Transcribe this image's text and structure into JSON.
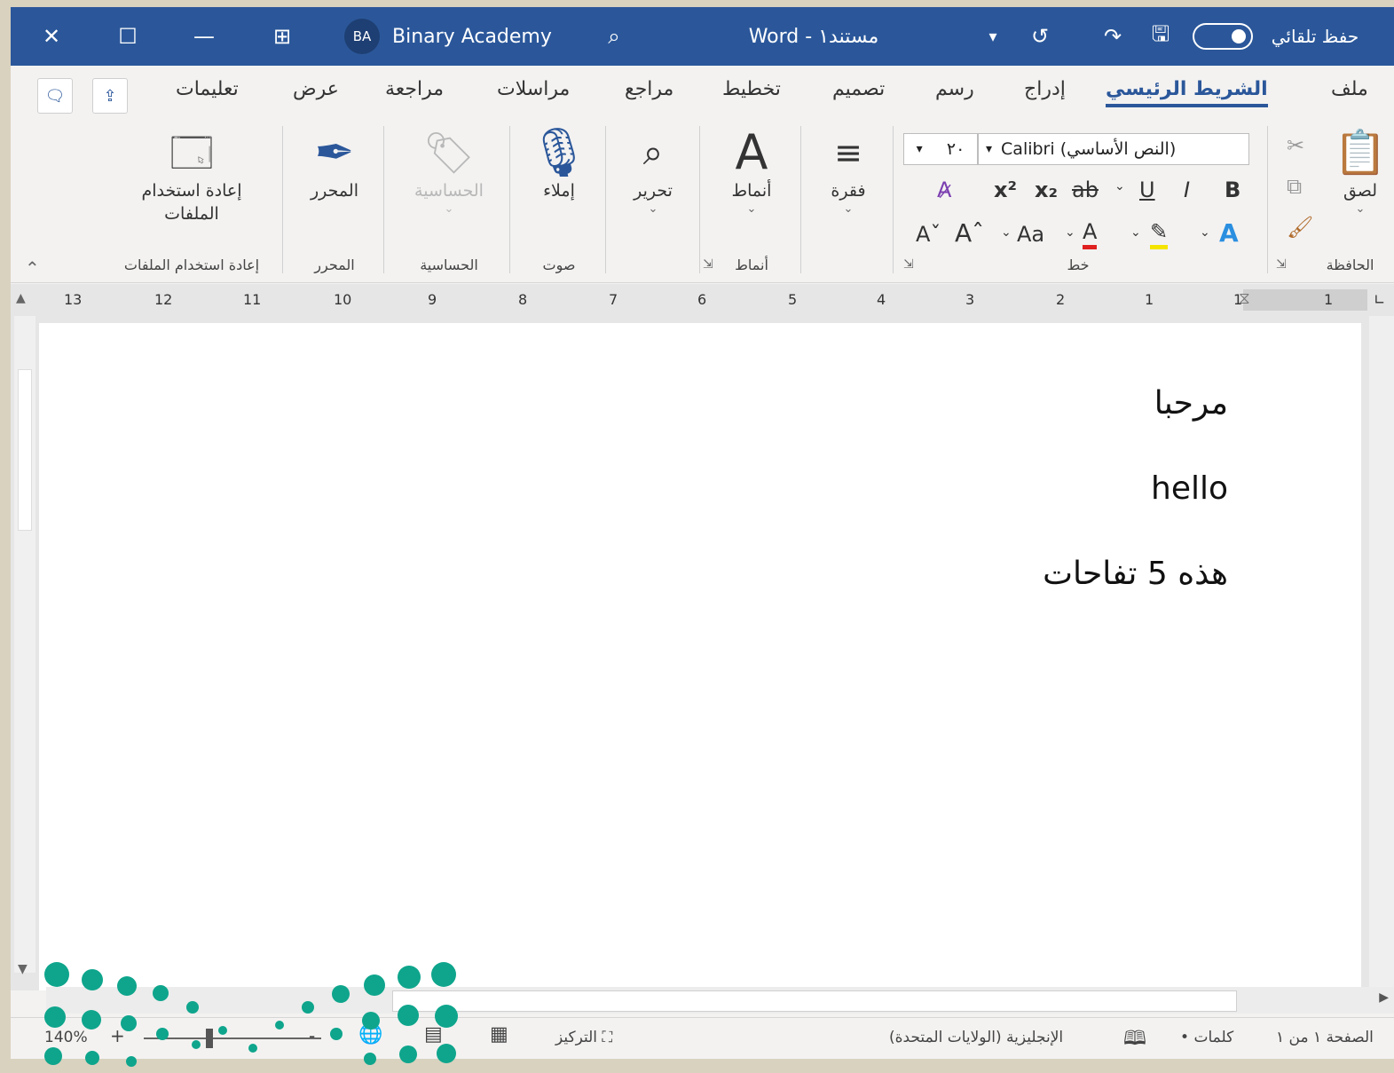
{
  "titlebar": {
    "app": "Word",
    "separator": "-",
    "document": "مستند١",
    "account_initials": "BA",
    "account_name": "Binary Academy",
    "autosave_label": "حفظ تلقائي",
    "icons": [
      "close-icon",
      "restore-icon",
      "minimize-icon",
      "ribbon-display-icon",
      "search-icon",
      "customize-icon",
      "undo-icon",
      "redo-icon",
      "save-icon"
    ]
  },
  "tabs": [
    "ملف",
    "الشريط الرئيسي",
    "إدراج",
    "رسم",
    "تصميم",
    "تخطيط",
    "مراجع",
    "مراسلات",
    "مراجعة",
    "عرض",
    "تعليمات"
  ],
  "ribbon": {
    "clipboard": {
      "paste": "لصق",
      "group": "الحافظة"
    },
    "font": {
      "name": "Calibri (النص الأساسي)",
      "size": "٢٠",
      "case": "Aa",
      "bold": "B",
      "italic": "I",
      "underline": "U",
      "strike": "ab",
      "subscript": "x₂",
      "superscript": "x²",
      "group": "خط"
    },
    "paragraph": {
      "label": "فقرة"
    },
    "styles": {
      "label": "أنماط",
      "group": "أنماط"
    },
    "editing": {
      "label": "تحرير"
    },
    "voice": {
      "label": "إملاء",
      "group": "صوت"
    },
    "sensitivity": {
      "label": "الحساسية",
      "group": "الحساسية"
    },
    "editor": {
      "label": "المحرر",
      "group": "المحرر"
    },
    "reuse": {
      "label_line1": "إعادة استخدام",
      "label_line2": "الملفات",
      "group": "إعادة استخدام الملفات"
    }
  },
  "ruler": {
    "numbers": [
      "1",
      "2",
      "3",
      "4",
      "5",
      "6",
      "7",
      "8",
      "9",
      "10",
      "11",
      "12",
      "13"
    ]
  },
  "document": {
    "lines": [
      "مرحبا",
      "hello",
      "هذه 5 تفاحات"
    ]
  },
  "statusbar": {
    "page": "الصفحة ١ من ١",
    "words": "• كلمات",
    "language": "الإنجليزية (الولايات المتحدة)",
    "focus": "التركيز",
    "zoom": "140%",
    "zoom_minus": "-",
    "zoom_plus": "+"
  },
  "colors": {
    "titlebar": "#2b579a",
    "accent": "#2b579a",
    "logo": "#0ea58c"
  }
}
